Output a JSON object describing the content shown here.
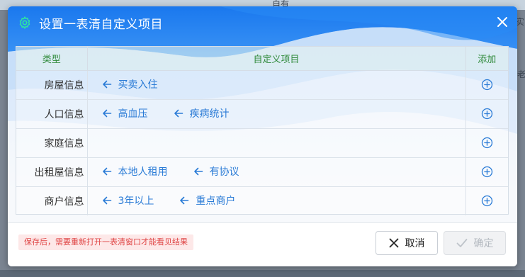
{
  "background": {
    "top_text": "自有",
    "right_text_1": "实",
    "right_text_2": "老"
  },
  "dialog": {
    "title": "设置一表清自定义项目",
    "title_icon": "gear-icon",
    "close_icon": "close-icon",
    "columns": {
      "type": "类型",
      "items": "自定义项目",
      "add": "添加"
    },
    "rows": [
      {
        "type": "房屋信息",
        "items": [
          "买卖入住"
        ]
      },
      {
        "type": "人口信息",
        "items": [
          "高血压",
          "疾病统计"
        ]
      },
      {
        "type": "家庭信息",
        "items": []
      },
      {
        "type": "出租屋信息",
        "items": [
          "本地人租用",
          "有协议"
        ]
      },
      {
        "type": "商户信息",
        "items": [
          "3年以上",
          "重点商户"
        ]
      }
    ],
    "item_icon": "arrow-left-icon",
    "add_icon": "plus-circle-icon",
    "notice": "保存后，需要重新打开一表清窗口才能看见结果",
    "cancel_label": "取消",
    "confirm_label": "确定",
    "colors": {
      "header_blue": "#1e80f0",
      "link_blue": "#2a7bd6",
      "column_header_green": "#2f8a3a",
      "notice_red": "#e04848"
    }
  }
}
